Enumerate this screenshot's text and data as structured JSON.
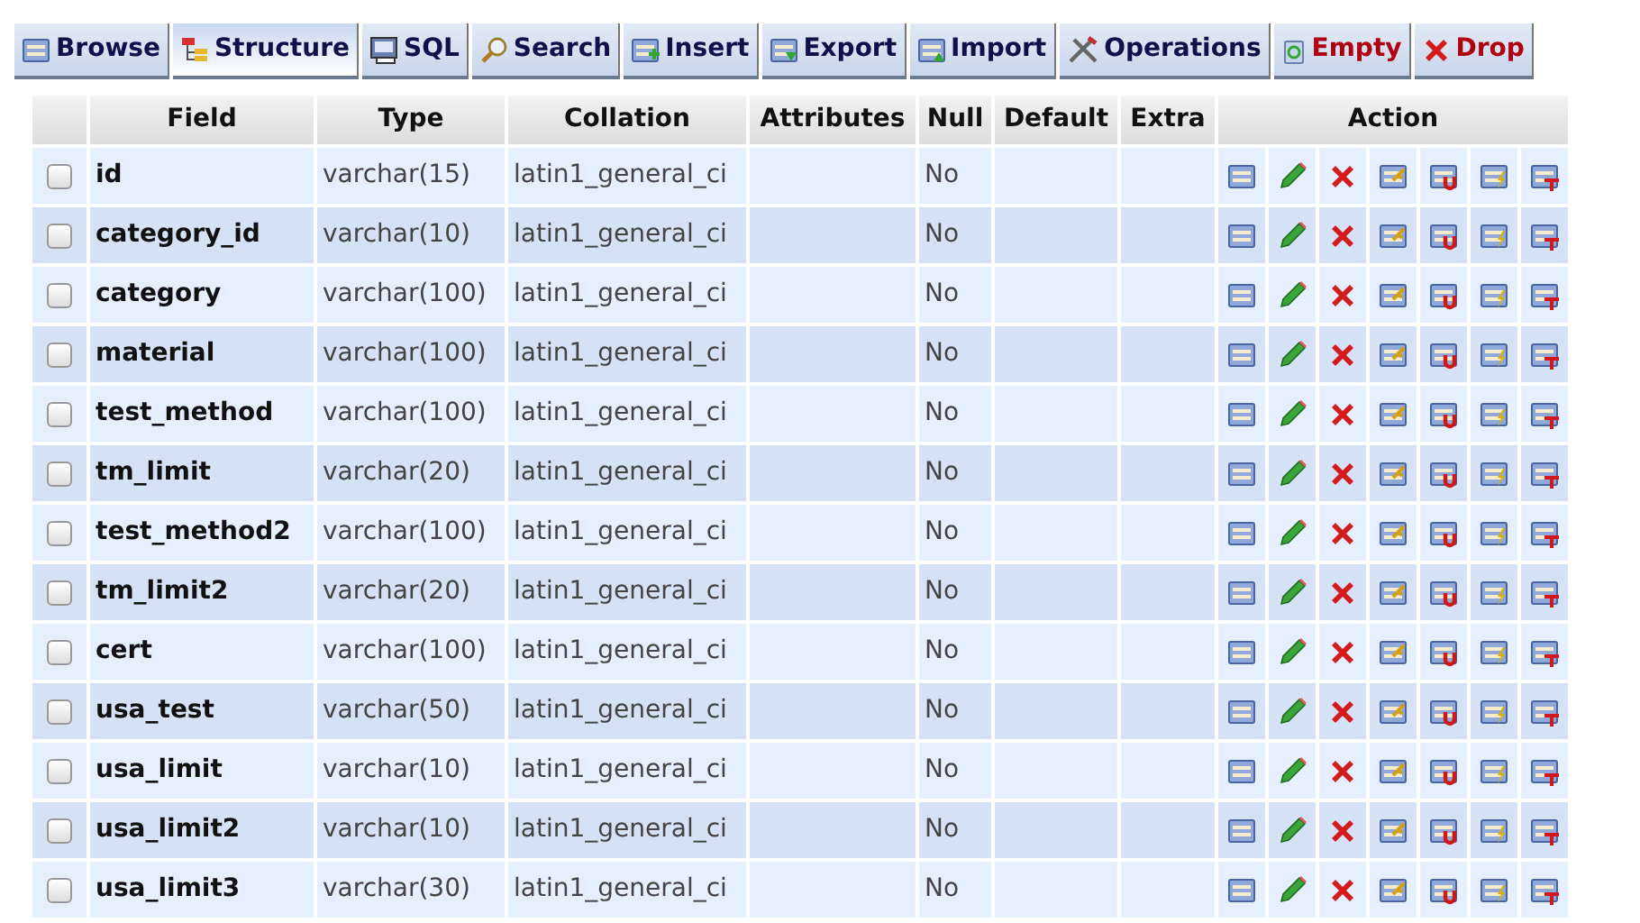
{
  "tabs": [
    {
      "label": "Browse",
      "selected": false,
      "kind": "normal"
    },
    {
      "label": "Structure",
      "selected": true,
      "kind": "normal"
    },
    {
      "label": "SQL",
      "selected": false,
      "kind": "normal"
    },
    {
      "label": "Search",
      "selected": false,
      "kind": "normal"
    },
    {
      "label": "Insert",
      "selected": false,
      "kind": "normal"
    },
    {
      "label": "Export",
      "selected": false,
      "kind": "normal"
    },
    {
      "label": "Import",
      "selected": false,
      "kind": "normal"
    },
    {
      "label": "Operations",
      "selected": false,
      "kind": "normal"
    },
    {
      "label": "Empty",
      "selected": false,
      "kind": "danger"
    },
    {
      "label": "Drop",
      "selected": false,
      "kind": "danger"
    }
  ],
  "table": {
    "columns": [
      "Field",
      "Type",
      "Collation",
      "Attributes",
      "Null",
      "Default",
      "Extra",
      "Action"
    ],
    "rows": [
      {
        "checked": false,
        "field": "id",
        "type": "varchar(15)",
        "collation": "latin1_general_ci",
        "null": "No"
      },
      {
        "checked": false,
        "field": "category_id",
        "type": "varchar(10)",
        "collation": "latin1_general_ci",
        "null": "No"
      },
      {
        "checked": false,
        "field": "category",
        "type": "varchar(100)",
        "collation": "latin1_general_ci",
        "null": "No"
      },
      {
        "checked": false,
        "field": "material",
        "type": "varchar(100)",
        "collation": "latin1_general_ci",
        "null": "No"
      },
      {
        "checked": false,
        "field": "test_method",
        "type": "varchar(100)",
        "collation": "latin1_general_ci",
        "null": "No"
      },
      {
        "checked": false,
        "field": "tm_limit",
        "type": "varchar(20)",
        "collation": "latin1_general_ci",
        "null": "No"
      },
      {
        "checked": false,
        "field": "test_method2",
        "type": "varchar(100)",
        "collation": "latin1_general_ci",
        "null": "No"
      },
      {
        "checked": false,
        "field": "tm_limit2",
        "type": "varchar(20)",
        "collation": "latin1_general_ci",
        "null": "No"
      },
      {
        "checked": false,
        "field": "cert",
        "type": "varchar(100)",
        "collation": "latin1_general_ci",
        "null": "No"
      },
      {
        "checked": false,
        "field": "usa_test",
        "type": "varchar(50)",
        "collation": "latin1_general_ci",
        "null": "No"
      },
      {
        "checked": false,
        "field": "usa_limit",
        "type": "varchar(10)",
        "collation": "latin1_general_ci",
        "null": "No"
      },
      {
        "checked": false,
        "field": "usa_limit2",
        "type": "varchar(10)",
        "collation": "latin1_general_ci",
        "null": "No"
      },
      {
        "checked": false,
        "field": "usa_limit3",
        "type": "varchar(30)",
        "collation": "latin1_general_ci",
        "null": "No"
      }
    ]
  }
}
